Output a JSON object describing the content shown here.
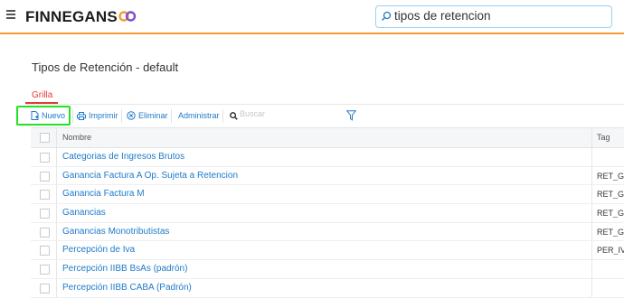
{
  "header": {
    "brand": "FINNEGANS",
    "search_value": "tipos de retencion"
  },
  "page": {
    "title": "Tipos de Retención - default",
    "tab": "Grilla"
  },
  "toolbar": {
    "nuevo": "Nuevo",
    "imprimir": "Imprimir",
    "eliminar": "Eliminar",
    "administrar": "Administrar",
    "search_placeholder": "Buscar"
  },
  "grid": {
    "columns": {
      "nombre": "Nombre",
      "tag": "Tag"
    },
    "rows": [
      {
        "nombre": "Categorias de Ingresos Brutos",
        "tag": ""
      },
      {
        "nombre": "Ganancia Factura A Op. Sujeta a Retencion",
        "tag": "RET_G"
      },
      {
        "nombre": "Ganancia Factura M",
        "tag": "RET_G"
      },
      {
        "nombre": "Ganancias",
        "tag": "RET_G"
      },
      {
        "nombre": "Ganancias Monotributistas",
        "tag": "RET_G"
      },
      {
        "nombre": "Percepción de Iva",
        "tag": "PER_IV"
      },
      {
        "nombre": "Percepción IIBB BsAs (padrón)",
        "tag": ""
      },
      {
        "nombre": "Percepción IIBB CABA (Padrón)",
        "tag": ""
      }
    ]
  },
  "colors": {
    "accent_orange": "#f39c33",
    "link_blue": "#1f7ac9",
    "tab_red": "#e23b3b",
    "highlight_green": "#22e322"
  }
}
